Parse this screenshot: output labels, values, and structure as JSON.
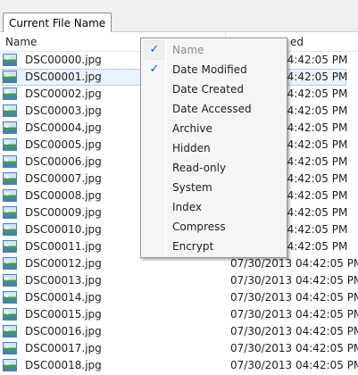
{
  "tab": {
    "label": "Current File Name"
  },
  "columns": {
    "name": "Name",
    "date_partial": "ed"
  },
  "files": [
    {
      "name": "DSC00000.jpg",
      "date": "04:42:05 PM"
    },
    {
      "name": "DSC00001.jpg",
      "date": "04:42:05 PM"
    },
    {
      "name": "DSC00002.jpg",
      "date": "04:42:05 PM"
    },
    {
      "name": "DSC00003.jpg",
      "date": "04:42:05 PM"
    },
    {
      "name": "DSC00004.jpg",
      "date": "04:42:05 PM"
    },
    {
      "name": "DSC00005.jpg",
      "date": "04:42:05 PM"
    },
    {
      "name": "DSC00006.jpg",
      "date": "04:42:05 PM"
    },
    {
      "name": "DSC00007.jpg",
      "date": "04:42:05 PM"
    },
    {
      "name": "DSC00008.jpg",
      "date": "04:42:05 PM"
    },
    {
      "name": "DSC00009.jpg",
      "date": "04:42:05 PM"
    },
    {
      "name": "DSC00010.jpg",
      "date": "04:42:05 PM"
    },
    {
      "name": "DSC00011.jpg",
      "date": "04:42:05 PM"
    },
    {
      "name": "DSC00012.jpg",
      "date": "07/30/2013 04:42:05 PM"
    },
    {
      "name": "DSC00013.jpg",
      "date": "07/30/2013 04:42:05 PM"
    },
    {
      "name": "DSC00014.jpg",
      "date": "07/30/2013 04:42:05 PM"
    },
    {
      "name": "DSC00015.jpg",
      "date": "07/30/2013 04:42:05 PM"
    },
    {
      "name": "DSC00016.jpg",
      "date": "07/30/2013 04:42:05 PM"
    },
    {
      "name": "DSC00017.jpg",
      "date": "07/30/2013 04:42:05 PM"
    },
    {
      "name": "DSC00018.jpg",
      "date": "07/30/2013 04:42:05 PM"
    }
  ],
  "selected_index": 1,
  "menu": {
    "check_glyph": "✓",
    "items": [
      {
        "label": "Name",
        "checked": true,
        "disabled": true
      },
      {
        "label": "Date Modified",
        "checked": true,
        "disabled": false
      },
      {
        "label": "Date Created",
        "checked": false,
        "disabled": false
      },
      {
        "label": "Date Accessed",
        "checked": false,
        "disabled": false
      },
      {
        "label": "Archive",
        "checked": false,
        "disabled": false
      },
      {
        "label": "Hidden",
        "checked": false,
        "disabled": false
      },
      {
        "label": "Read-only",
        "checked": false,
        "disabled": false
      },
      {
        "label": "System",
        "checked": false,
        "disabled": false
      },
      {
        "label": "Index",
        "checked": false,
        "disabled": false
      },
      {
        "label": "Compress",
        "checked": false,
        "disabled": false
      },
      {
        "label": "Encrypt",
        "checked": false,
        "disabled": false
      }
    ]
  },
  "colors": {
    "check": "#0a64c8",
    "disabled_text": "#8d8d8d",
    "selection_border": "#8aa8d0"
  }
}
